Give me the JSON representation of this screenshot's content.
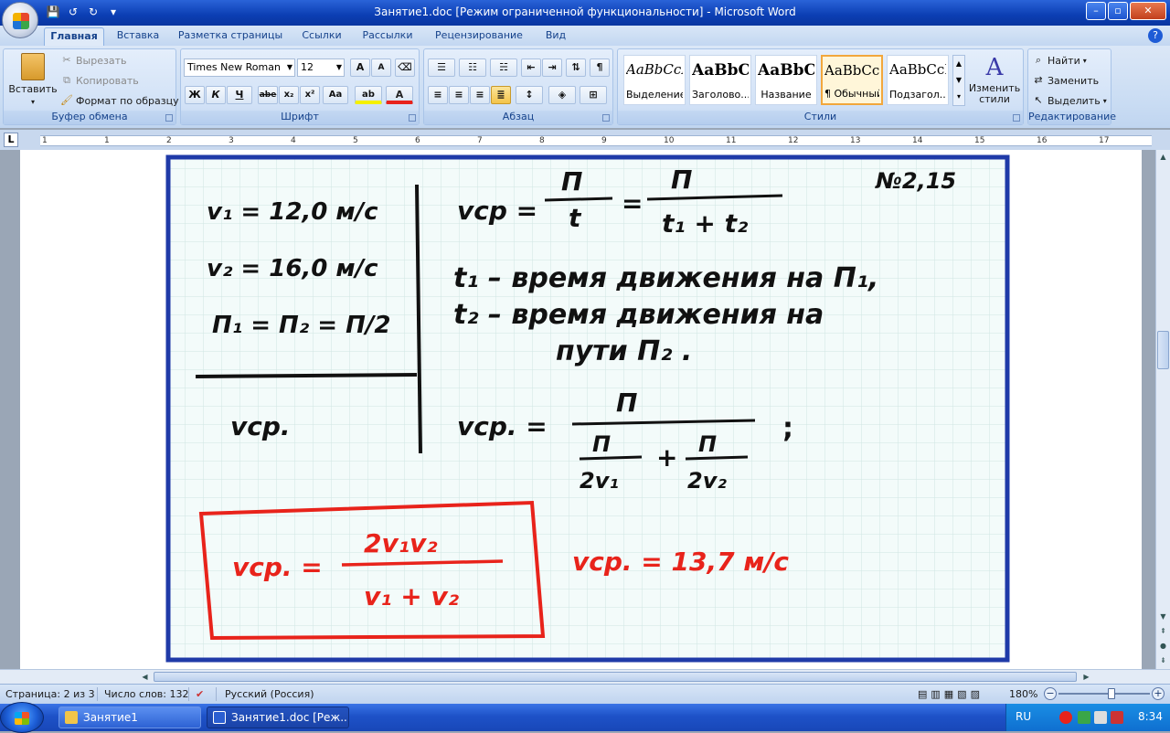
{
  "window": {
    "title": "Занятие1.doc [Режим ограниченной функциональности] - Microsoft Word",
    "controls": {
      "minimize": "–",
      "maximize": "▫",
      "close": "✕"
    }
  },
  "qat": {
    "save": "💾",
    "undo": "↺",
    "redo": "↻",
    "more": "▾"
  },
  "tabs": [
    "Главная",
    "Вставка",
    "Разметка страницы",
    "Ссылки",
    "Рассылки",
    "Рецензирование",
    "Вид"
  ],
  "help": "?",
  "clipboard": {
    "paste": "Вставить",
    "cut": "Вырезать",
    "copy": "Копировать",
    "format_painter": "Формат по образцу",
    "label": "Буфер обмена"
  },
  "font": {
    "name": "Times New Roman",
    "size": "12",
    "grow": "A",
    "shrink": "A",
    "clear": "⌫",
    "bold": "Ж",
    "italic": "К",
    "underline": "Ч",
    "strike": "abe",
    "sub": "x₂",
    "sup": "x²",
    "case": "Aa",
    "highlight": "ab",
    "color": "A",
    "label": "Шрифт"
  },
  "paragraph": {
    "label": "Абзац",
    "pilcrow": "¶"
  },
  "styles": {
    "label": "Стили",
    "items": [
      {
        "preview": "AaBbCcI",
        "name": "Выделение"
      },
      {
        "preview": "AaBbC",
        "name": "Заголово..."
      },
      {
        "preview": "AaBbC",
        "name": "Название"
      },
      {
        "preview": "AaBbCcI",
        "name": "¶ Обычный"
      },
      {
        "preview": "AaBbCcI",
        "name": "Подзагол..."
      }
    ],
    "change_styles": "Изменить стили",
    "change_glyph": "A"
  },
  "editing": {
    "label": "Редактирование",
    "find": "Найти",
    "replace": "Заменить",
    "select": "Выделить"
  },
  "ruler": {
    "tab_glyph": "L",
    "numbers": [
      "1",
      "1",
      "2",
      "3",
      "4",
      "5",
      "6",
      "7",
      "8",
      "9",
      "10",
      "11",
      "12",
      "13",
      "14",
      "15",
      "16",
      "17"
    ]
  },
  "document": {
    "problem_number": "№2,15",
    "given": [
      "v₁ = 12,0 м/с",
      "v₂ = 16,0 м/с",
      "П₁ = П₂ = П/2"
    ],
    "find": "vср.",
    "formula_1_lhs": "vср =",
    "formula_1_num1": "П",
    "formula_1_den1": "t",
    "formula_1_eq": "=",
    "formula_1_num2": "П",
    "formula_1_den2": "t₁ + t₂",
    "note_1": "t₁ – время движения на П₁,",
    "note_2": "t₂ – время движения на",
    "note_3": "пути П₂ .",
    "formula_2_lhs": "vср. =",
    "formula_2_num": "П",
    "formula_2_den_a_num": "П",
    "formula_2_den_a_den": "2v₁",
    "formula_2_plus": "+",
    "formula_2_den_b_num": "П",
    "formula_2_den_b_den": "2v₂",
    "formula_2_end": ";",
    "answer_lhs": "vср. =",
    "answer_num": "2v₁v₂",
    "answer_den": "v₁ + v₂",
    "result": "vср. = 13,7 м/с",
    "colors": {
      "ink": "#111111",
      "red": "#e8231b",
      "frame": "#1f3aa8",
      "grid": "#cfe6e3"
    }
  },
  "status": {
    "page": "Страница: 2 из 3",
    "words": "Число слов: 132",
    "lang": "Русский (Россия)",
    "zoom": "180%",
    "zoom_minus": "−",
    "zoom_plus": "+"
  },
  "taskbar": {
    "items": [
      "Занятие1",
      "Занятие1.doc [Реж..."
    ],
    "lang": "RU",
    "time": "8:34"
  }
}
